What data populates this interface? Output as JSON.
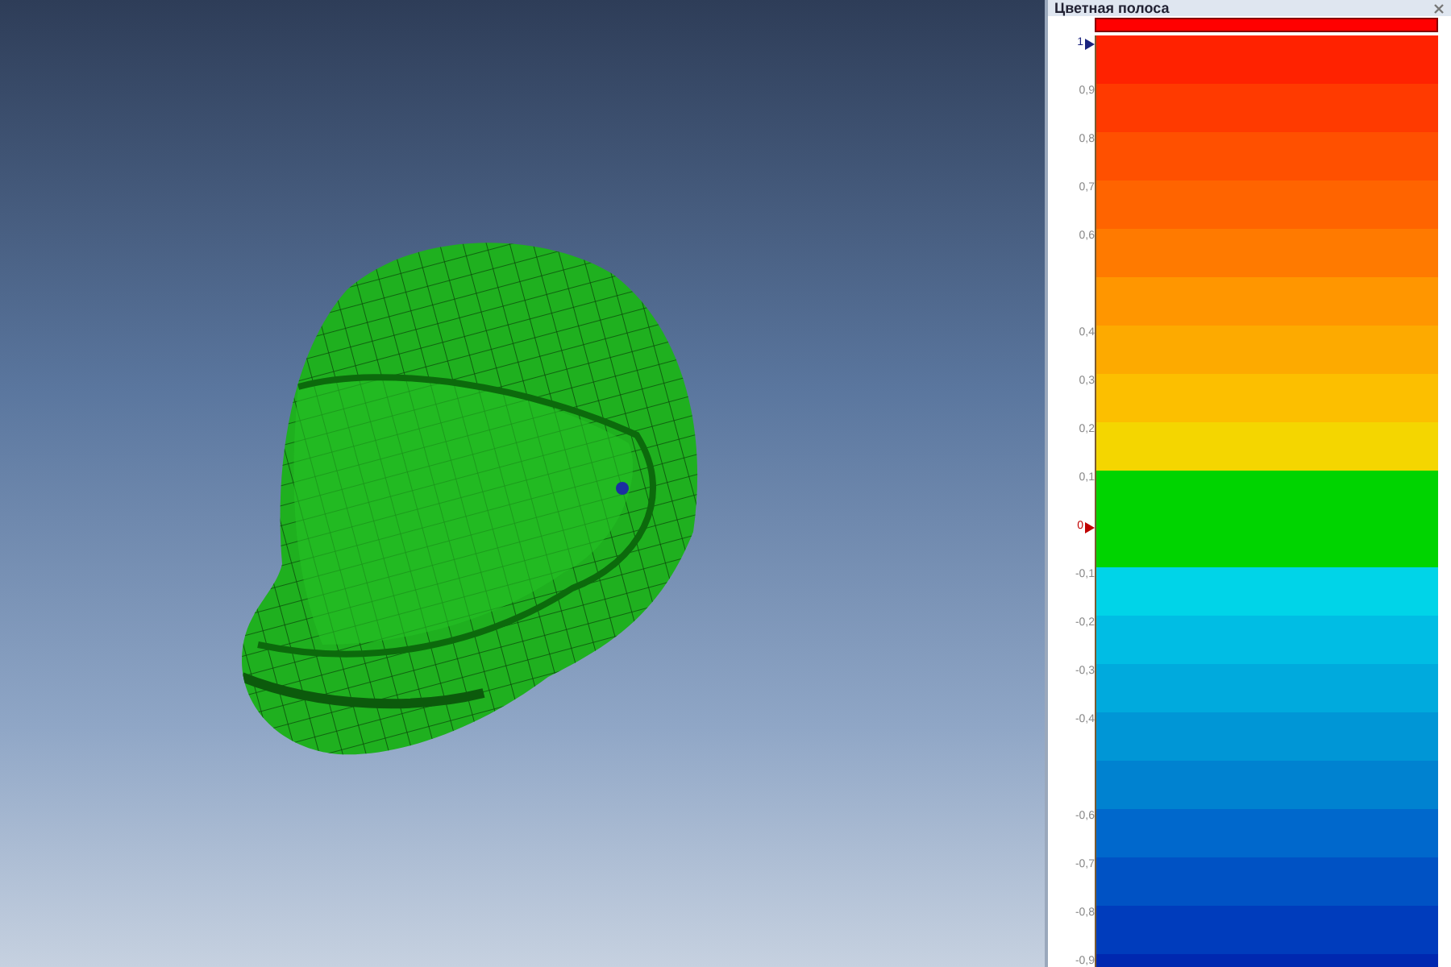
{
  "color_bar_panel": {
    "title": "Цветная полоса",
    "ticks": [
      {
        "label": "1",
        "kind": "max-marker"
      },
      {
        "label": "0,9",
        "kind": "plain"
      },
      {
        "label": "0,8",
        "kind": "plain"
      },
      {
        "label": "0,7",
        "kind": "plain"
      },
      {
        "label": "0,6",
        "kind": "plain"
      },
      {
        "kind": "blank"
      },
      {
        "label": "0,4",
        "kind": "plain"
      },
      {
        "label": "0,3",
        "kind": "plain"
      },
      {
        "label": "0,2",
        "kind": "plain"
      },
      {
        "label": "0,1",
        "kind": "plain"
      },
      {
        "label": "0",
        "kind": "zero-marker"
      },
      {
        "label": "-0,1",
        "kind": "plain"
      },
      {
        "label": "-0,2",
        "kind": "plain"
      },
      {
        "label": "-0,3",
        "kind": "plain"
      },
      {
        "label": "-0,4",
        "kind": "plain"
      },
      {
        "kind": "blank"
      },
      {
        "label": "-0,6",
        "kind": "plain"
      },
      {
        "label": "-0,7",
        "kind": "plain"
      },
      {
        "label": "-0,8",
        "kind": "plain"
      },
      {
        "label": "-0,9",
        "kind": "plain"
      }
    ],
    "bands": [
      {
        "color": "#ff2200",
        "kind": "normal"
      },
      {
        "color": "#ff3a00",
        "kind": "normal"
      },
      {
        "color": "#ff5000",
        "kind": "normal"
      },
      {
        "color": "#ff6400",
        "kind": "normal"
      },
      {
        "color": "#ff7a00",
        "kind": "normal"
      },
      {
        "color": "#ff9600",
        "kind": "normal"
      },
      {
        "color": "#fdaa00",
        "kind": "normal"
      },
      {
        "color": "#fcbf00",
        "kind": "normal"
      },
      {
        "color": "#f4d600",
        "kind": "normal"
      },
      {
        "color": "#00d400",
        "kind": "wide"
      },
      {
        "color": "#00d4e8",
        "kind": "normal"
      },
      {
        "color": "#00bde4",
        "kind": "normal"
      },
      {
        "color": "#00aadd",
        "kind": "normal"
      },
      {
        "color": "#0096d6",
        "kind": "normal"
      },
      {
        "color": "#0082d0",
        "kind": "normal"
      },
      {
        "color": "#0068cc",
        "kind": "normal"
      },
      {
        "color": "#0052c4",
        "kind": "normal"
      },
      {
        "color": "#003cbc",
        "kind": "normal"
      },
      {
        "color": "#0028b0",
        "kind": "normal"
      }
    ]
  }
}
